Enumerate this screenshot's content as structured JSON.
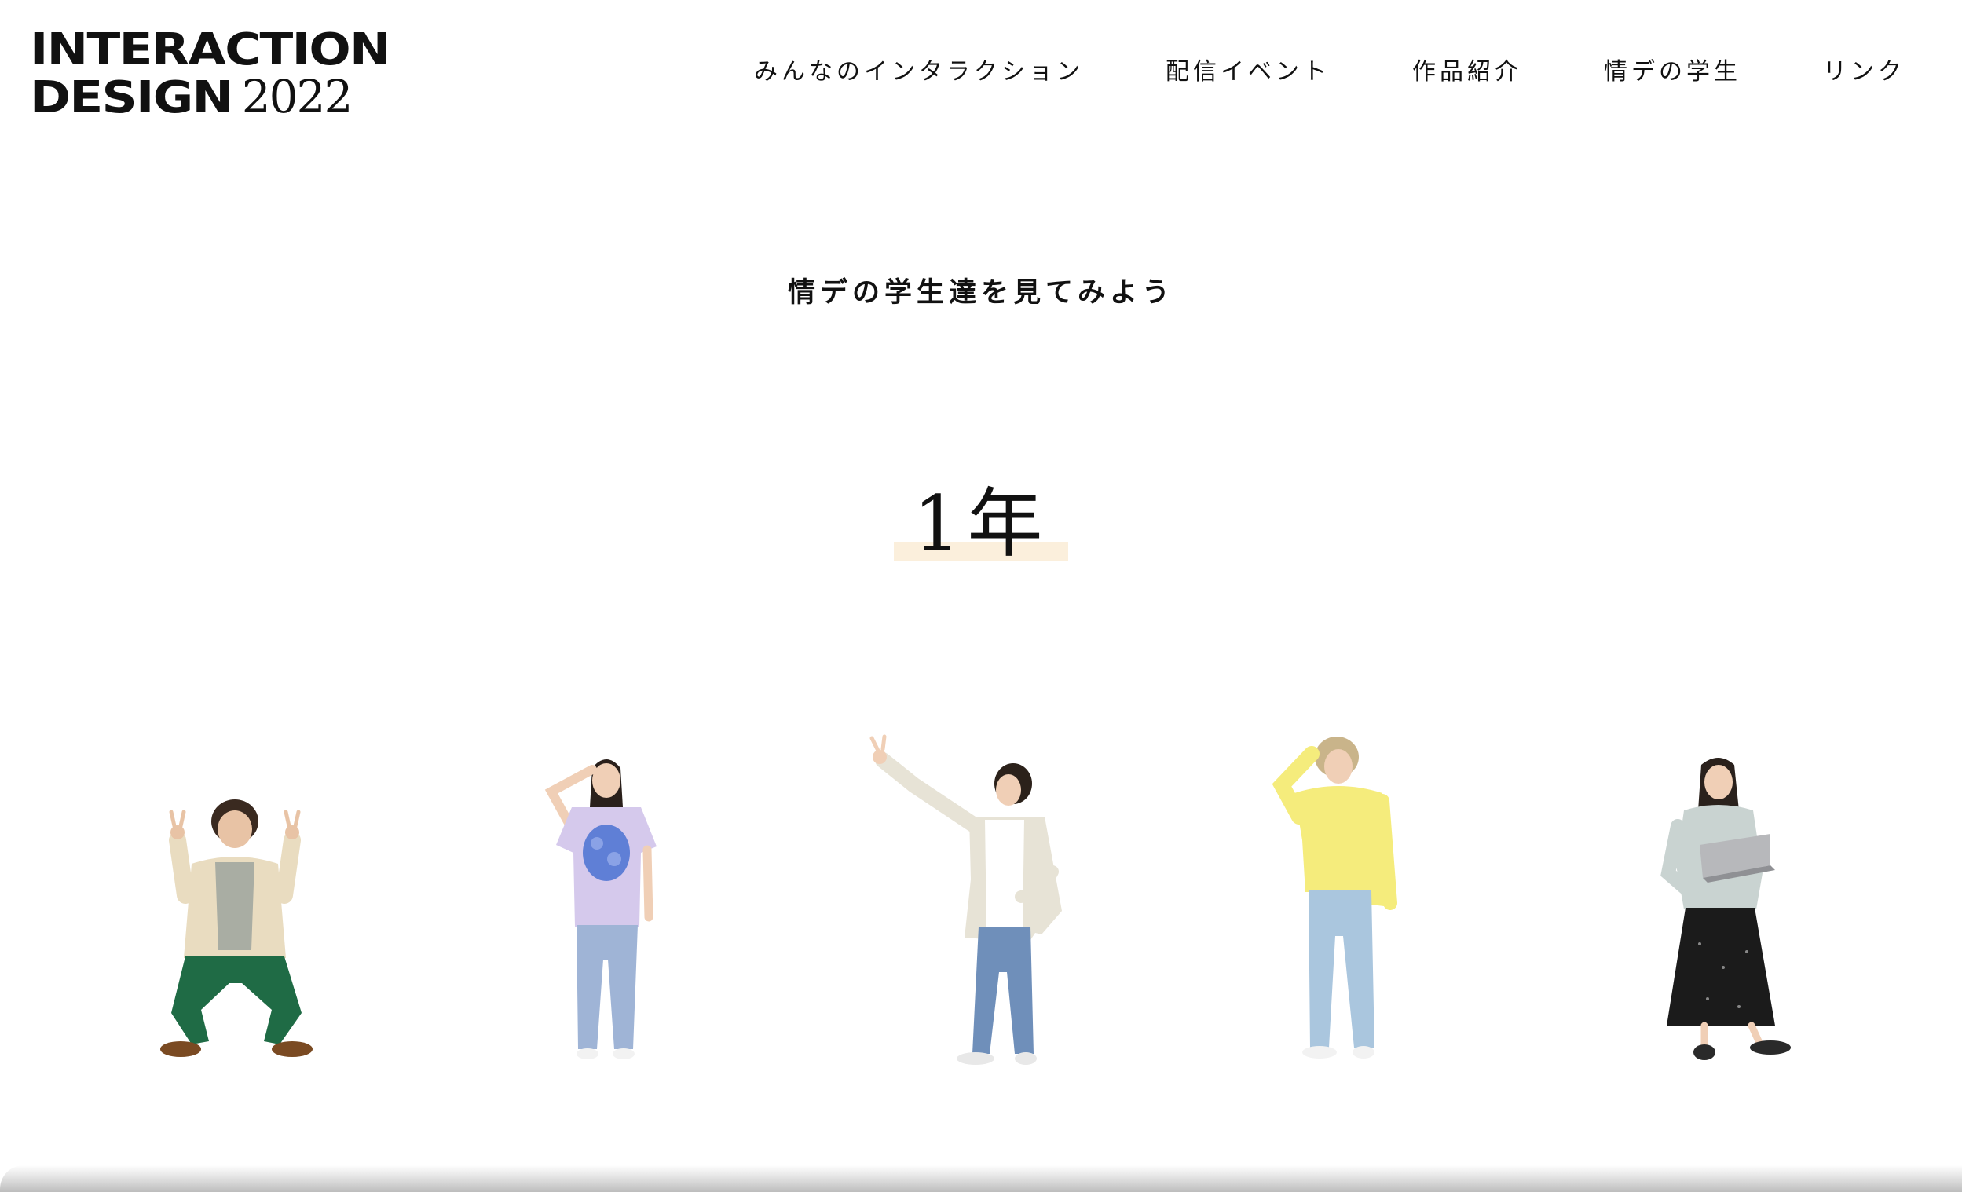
{
  "header": {
    "logo": {
      "line1": "INTERACTION",
      "design": "DESIGN",
      "year": "2022"
    },
    "nav": [
      {
        "label": "みんなのインタラクション"
      },
      {
        "label": "配信イベント"
      },
      {
        "label": "作品紹介"
      },
      {
        "label": "情デの学生"
      },
      {
        "label": "リンク"
      }
    ]
  },
  "main": {
    "intro": "情デの学生達を見てみよう",
    "year_heading": "1年",
    "highlight_color": "#fbefdc",
    "students": [
      {
        "icon": "student-photo",
        "outfit": "beige jacket, gray hoodie, green pants",
        "shirt": "#e9dcc0",
        "inner": "#a9ada3",
        "pants": "#1f6b45",
        "shoes": "#7a4a22",
        "hair": "#3a2a20"
      },
      {
        "icon": "student-photo",
        "outfit": "lavender t-shirt, plaid jeans",
        "shirt": "#d5c9ec",
        "inner": "#5f7fd6",
        "pants": "#9fb4d6",
        "shoes": "#f2f2f2",
        "hair": "#2a201b"
      },
      {
        "icon": "student-photo",
        "outfit": "cream jacket, white tee, jeans",
        "shirt": "#e7e3d6",
        "inner": "#ffffff",
        "pants": "#6f8fba",
        "shoes": "#e8e8e8",
        "hair": "#2b211a"
      },
      {
        "icon": "student-photo",
        "outfit": "yellow sweatshirt, light jeans",
        "shirt": "#f5ec7c",
        "inner": "#f5ec7c",
        "pants": "#aac6de",
        "shoes": "#f2f2f2",
        "hair": "#c9b48a"
      },
      {
        "icon": "student-photo",
        "outfit": "mint hoodie, dotted skirt, laptop",
        "shirt": "#c9d3d1",
        "inner": "#c9d3d1",
        "pants": "#1b1b1b",
        "shoes": "#2a2a2a",
        "hair": "#2a211c"
      }
    ]
  }
}
